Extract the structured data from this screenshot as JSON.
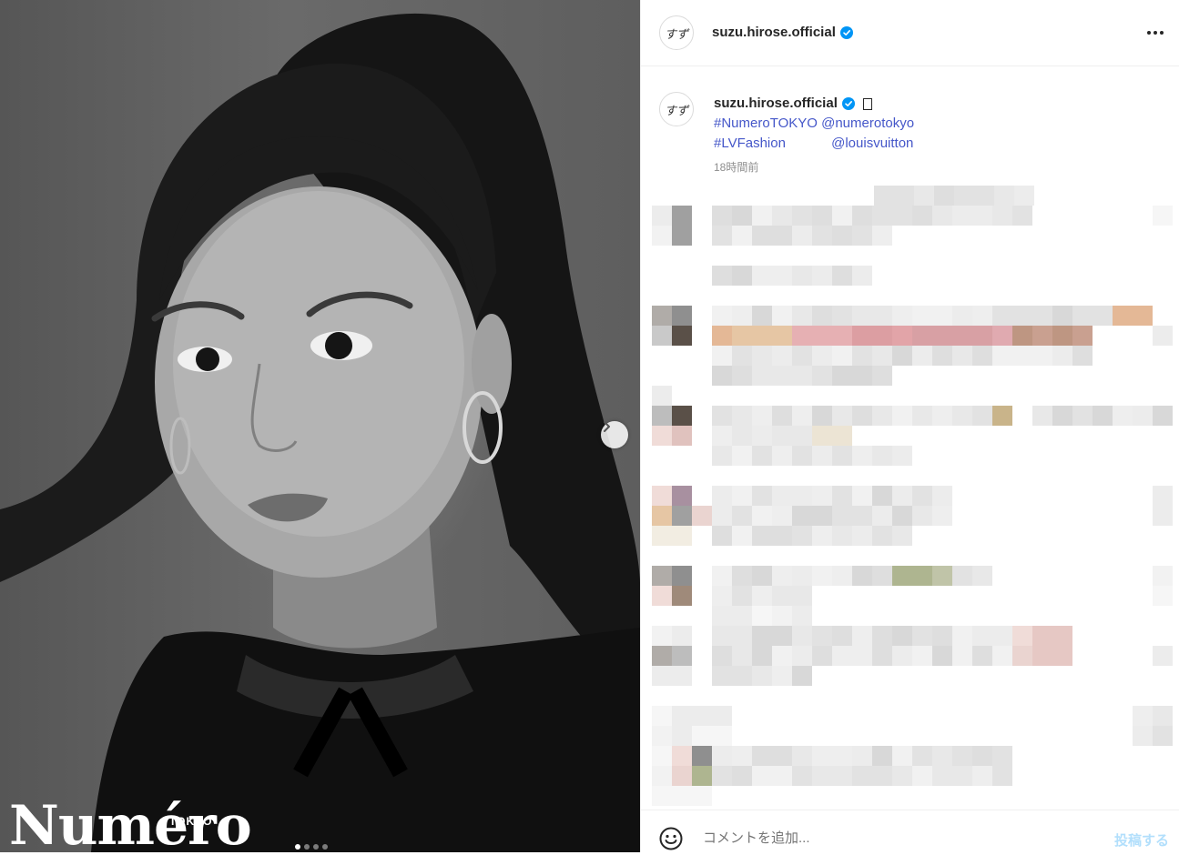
{
  "post": {
    "brand_text": "Numéro",
    "brand_sub": "TOKYO",
    "carousel_dots": 4,
    "active_dot": 0
  },
  "header": {
    "username": "suzu.hirose.official",
    "avatar_sig": "すず",
    "more_icon": "more-horizontal-icon"
  },
  "caption": {
    "username": "suzu.hirose.official",
    "line1_tag1": "#NumeroTOKYO",
    "line1_tag2": "@numerotokyo",
    "line2_tag1": "#LVFashion",
    "line2_tag2": "@louisvuitton",
    "time": "18時間前"
  },
  "comment_box": {
    "placeholder": "コメントを追加...",
    "post_label": "投稿する"
  },
  "colors": {
    "link": "#4557c9",
    "verified": "#0095f6",
    "post_disabled": "#b2dffc"
  }
}
